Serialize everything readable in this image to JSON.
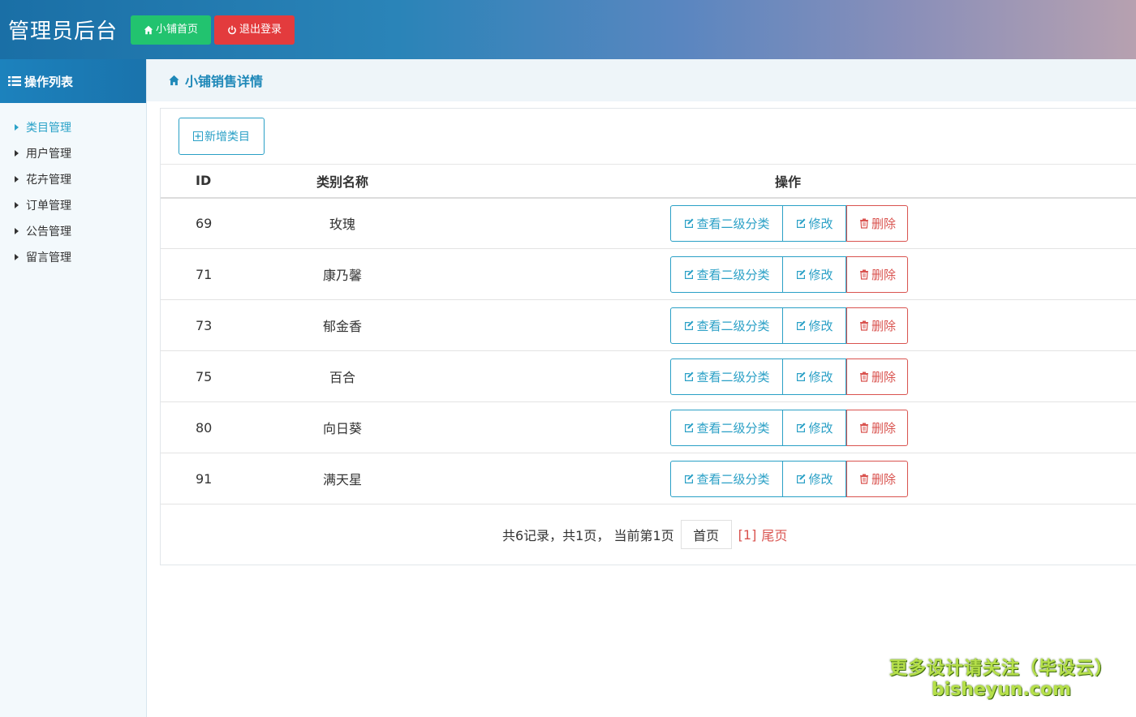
{
  "header": {
    "title": "管理员后台",
    "home_label": "小铺首页",
    "logout_label": "退出登录",
    "home_color": "#22c36f",
    "logout_color": "#e33b3d"
  },
  "sidebar": {
    "title": "操作列表",
    "items": [
      {
        "label": "类目管理",
        "active": true
      },
      {
        "label": "用户管理"
      },
      {
        "label": "花卉管理"
      },
      {
        "label": "订单管理"
      },
      {
        "label": "公告管理"
      },
      {
        "label": "留言管理"
      }
    ]
  },
  "main": {
    "breadcrumb": "小铺销售详情",
    "add_label": "新增类目",
    "columns": [
      "ID",
      "类别名称",
      "操作"
    ],
    "rows": [
      {
        "id": "69",
        "name": "玫瑰"
      },
      {
        "id": "71",
        "name": "康乃馨"
      },
      {
        "id": "73",
        "name": "郁金香"
      },
      {
        "id": "75",
        "name": "百合"
      },
      {
        "id": "80",
        "name": "向日葵"
      },
      {
        "id": "91",
        "name": "满天星"
      }
    ],
    "actions": {
      "view": "查看二级分类",
      "edit": "修改",
      "delete": "删除"
    },
    "pager": {
      "info": "共6记录，共1页， 当前第1页",
      "first": "首页",
      "current": "[1]",
      "last": "尾页"
    }
  },
  "watermark": {
    "line1": "更多设计请关注（毕设云）",
    "line2": "bisheyun.com"
  }
}
